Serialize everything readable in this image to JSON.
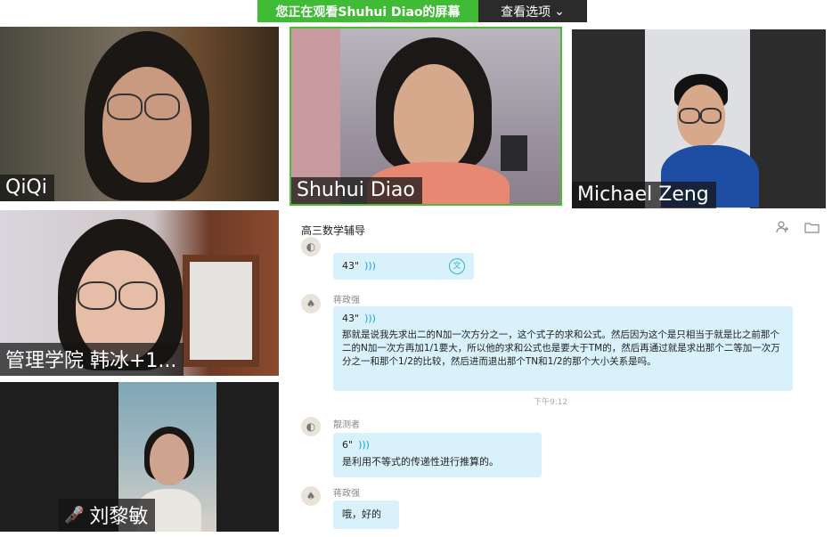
{
  "banner": {
    "viewing_text": "您正在观看Shuhui  Diao的屏幕",
    "view_options": "查看选项",
    "chevron": "chevron-down-icon"
  },
  "participants": [
    {
      "name": "QiQi"
    },
    {
      "name": "Shuhui Diao"
    },
    {
      "name": "Michael Zeng"
    },
    {
      "name": "管理学院 韩冰+1..."
    },
    {
      "name": "刘黎敏",
      "muted_icon": "mic-muted-icon"
    }
  ],
  "chat": {
    "title": "高三数学辅导",
    "icons": [
      "add-user-icon",
      "folder-icon"
    ],
    "messages": [
      {
        "voice": "43\"",
        "has_translate": true
      },
      {
        "sender": "蒋政强",
        "voice": "43\"",
        "text": "那就是说我先求出二的N加一次方分之一，这个式子的求和公式。然后因为这个是只相当于就是比之前那个二的N加一次方再加1/1要大，所以他的求和公式也是要大于TM的，然后再通过就是求出那个二等加一次万分之一和那个1/2的比较，然后进而退出那个TN和1/2的那个大小关系是吗。"
      },
      {
        "timestamp": "下午9:12"
      },
      {
        "sender": "靓测者",
        "voice": "6\"",
        "text": "是利用不等式的传递性进行推算的。"
      },
      {
        "sender": "蒋政强",
        "text": "哦，好的"
      }
    ]
  },
  "colors": {
    "banner_green": "#3fbb36",
    "bubble_blue": "#d8f1fb",
    "voice_wave": "#19a0d8"
  }
}
